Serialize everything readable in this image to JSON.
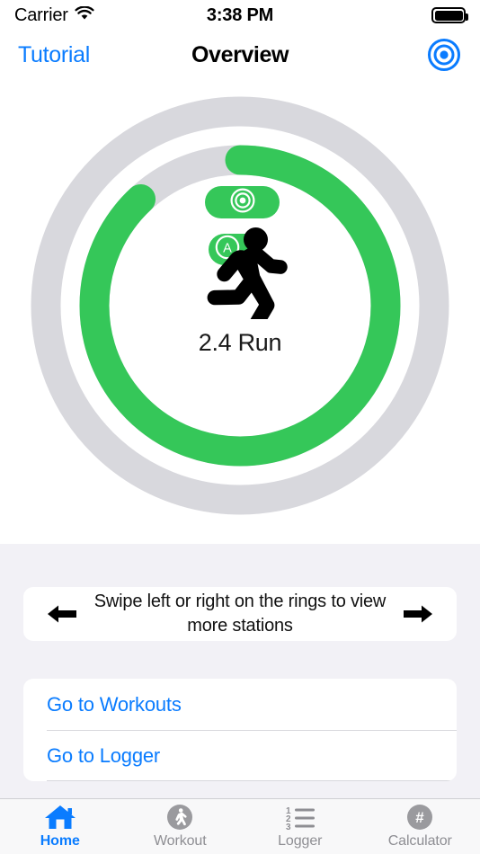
{
  "status_bar": {
    "carrier": "Carrier",
    "wifi_icon": "wifi-icon",
    "time": "3:38 PM",
    "battery_icon": "battery-full-icon"
  },
  "nav_bar": {
    "back_label": "Tutorial",
    "title": "Overview",
    "right_icon": "target-bullseye-icon",
    "right_icon_color": "#0a7cff"
  },
  "rings": {
    "center_label": "2.4 Run",
    "center_icon": "running-person-icon",
    "track_color": "#d8d8dd",
    "progress_color": "#35c759",
    "outer_ring": {
      "badge_icon": "target-bullseye-icon",
      "progress_percent": 0,
      "track_only": true
    },
    "inner_ring": {
      "badge_letter": "A",
      "badge_icon": "circled-letter-a-icon",
      "progress_percent": 88
    }
  },
  "hint": {
    "text": "Swipe left or right on the rings to view more stations",
    "left_icon": "arrow-left-icon",
    "right_icon": "arrow-right-icon"
  },
  "links": [
    {
      "label": "Go to Workouts",
      "name": "go-to-workouts"
    },
    {
      "label": "Go to Logger",
      "name": "go-to-logger"
    }
  ],
  "tab_bar": {
    "active_color": "#0a7cff",
    "inactive_color": "#8e8e93",
    "items": [
      {
        "label": "Home",
        "icon": "home-icon",
        "active": true
      },
      {
        "label": "Workout",
        "icon": "walking-person-circle-icon",
        "active": false
      },
      {
        "label": "Logger",
        "icon": "numbered-list-icon",
        "active": false
      },
      {
        "label": "Calculator",
        "icon": "hash-circle-icon",
        "active": false
      }
    ]
  },
  "logger_icon_numbers": {
    "one": "1",
    "two": "2",
    "three": "3"
  },
  "calculator_icon_glyph": "#"
}
